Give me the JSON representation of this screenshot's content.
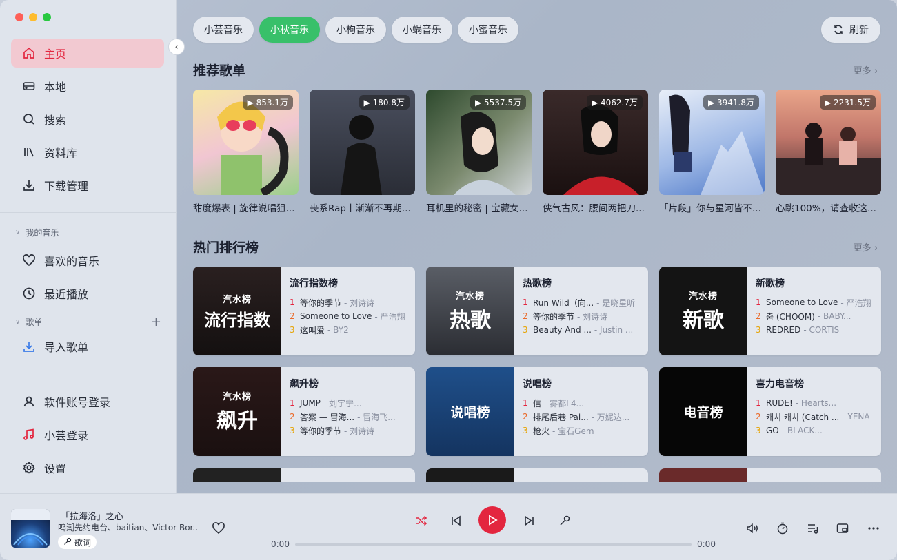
{
  "sidebar": {
    "nav": [
      {
        "label": "主页",
        "icon": "home-icon"
      },
      {
        "label": "本地",
        "icon": "drive-icon"
      },
      {
        "label": "搜索",
        "icon": "search-icon"
      },
      {
        "label": "资料库",
        "icon": "library-icon"
      },
      {
        "label": "下载管理",
        "icon": "download-icon"
      }
    ],
    "my_music_title": "我的音乐",
    "my_music": [
      {
        "label": "喜欢的音乐",
        "icon": "heart-icon"
      },
      {
        "label": "最近播放",
        "icon": "clock-icon"
      }
    ],
    "playlist_title": "歌单",
    "import_label": "导入歌单",
    "bottom": [
      {
        "label": "软件账号登录",
        "icon": "user-icon"
      },
      {
        "label": "小芸登录",
        "icon": "music-note-icon"
      },
      {
        "label": "设置",
        "icon": "gear-icon"
      }
    ]
  },
  "tabs": [
    {
      "label": "小芸音乐",
      "active": false
    },
    {
      "label": "小秋音乐",
      "active": true
    },
    {
      "label": "小枸音乐",
      "active": false
    },
    {
      "label": "小蜗音乐",
      "active": false
    },
    {
      "label": "小蜜音乐",
      "active": false
    }
  ],
  "refresh_label": "刷新",
  "recommend": {
    "title": "推荐歌单",
    "more": "更多",
    "items": [
      {
        "name": "甜度爆表 | 旋律说唱狙...",
        "count": "853.1万"
      },
      {
        "name": "丧系Rap丨渐渐不再期...",
        "count": "180.8万"
      },
      {
        "name": "耳机里的秘密 | 宝藏女...",
        "count": "5537.5万"
      },
      {
        "name": "侠气古风：腰间两把刀...",
        "count": "4062.7万"
      },
      {
        "name": "「片段」你与星河皆不...",
        "count": "3941.8万"
      },
      {
        "name": "心跳100%，请查收这...",
        "count": "2231.5万"
      }
    ]
  },
  "charts": {
    "title": "热门排行榜",
    "more": "更多",
    "items": [
      {
        "title": "流行指数榜",
        "cover_text": "流行指数",
        "brand": "汽水榜",
        "rows": [
          {
            "rank": "1",
            "song": "等你的季节",
            "artist": "- 刘诗诗"
          },
          {
            "rank": "2",
            "song": "Someone to Love",
            "artist": "- 严浩翔"
          },
          {
            "rank": "3",
            "song": "这叫爱",
            "artist": "- BY2"
          }
        ]
      },
      {
        "title": "热歌榜",
        "cover_text": "热歌",
        "brand": "汽水榜",
        "rows": [
          {
            "rank": "1",
            "song": "Run Wild（向...",
            "artist": "- 是晓星昕"
          },
          {
            "rank": "2",
            "song": "等你的季节",
            "artist": "- 刘诗诗"
          },
          {
            "rank": "3",
            "song": "Beauty And ...",
            "artist": "- Justin ..."
          }
        ]
      },
      {
        "title": "新歌榜",
        "cover_text": "新歌",
        "brand": "汽水榜",
        "rows": [
          {
            "rank": "1",
            "song": "Someone to Love",
            "artist": "- 严浩翔"
          },
          {
            "rank": "2",
            "song": "춤 (CHOOM)",
            "artist": "- BABY..."
          },
          {
            "rank": "3",
            "song": "REDRED",
            "artist": "- CORTIS"
          }
        ]
      },
      {
        "title": "飙升榜",
        "cover_text": "飙升",
        "brand": "汽水榜",
        "rows": [
          {
            "rank": "1",
            "song": "JUMP",
            "artist": "- 刘宇宁..."
          },
          {
            "rank": "2",
            "song": "答案 — 冒海...",
            "artist": "- 冒海飞..."
          },
          {
            "rank": "3",
            "song": "等你的季节",
            "artist": "- 刘诗诗"
          }
        ]
      },
      {
        "title": "说唱榜",
        "cover_text": "说唱榜",
        "brand": "",
        "rows": [
          {
            "rank": "1",
            "song": "信",
            "artist": "- 雾都L4..."
          },
          {
            "rank": "2",
            "song": "排尾后巷 Pai...",
            "artist": "- 万妮达..."
          },
          {
            "rank": "3",
            "song": "枪火",
            "artist": "- 宝石Gem"
          }
        ]
      },
      {
        "title": "喜力电音榜",
        "cover_text": "电音榜",
        "brand": "",
        "rows": [
          {
            "rank": "1",
            "song": "RUDE!",
            "artist": "- Hearts..."
          },
          {
            "rank": "2",
            "song": "캐치 캐치 (Catch ...",
            "artist": "- YENA"
          },
          {
            "rank": "3",
            "song": "GO",
            "artist": "- BLACK..."
          }
        ]
      }
    ]
  },
  "player": {
    "title": "「拉海洛」之心",
    "artist": "鸣潮先约电台、baitian、Victor Bor...",
    "lyric_label": "歌词",
    "time_current": "0:00",
    "time_total": "0:00"
  },
  "colors": {
    "accent_red": "#e3263f",
    "active_tab_green": "#38c06a"
  }
}
